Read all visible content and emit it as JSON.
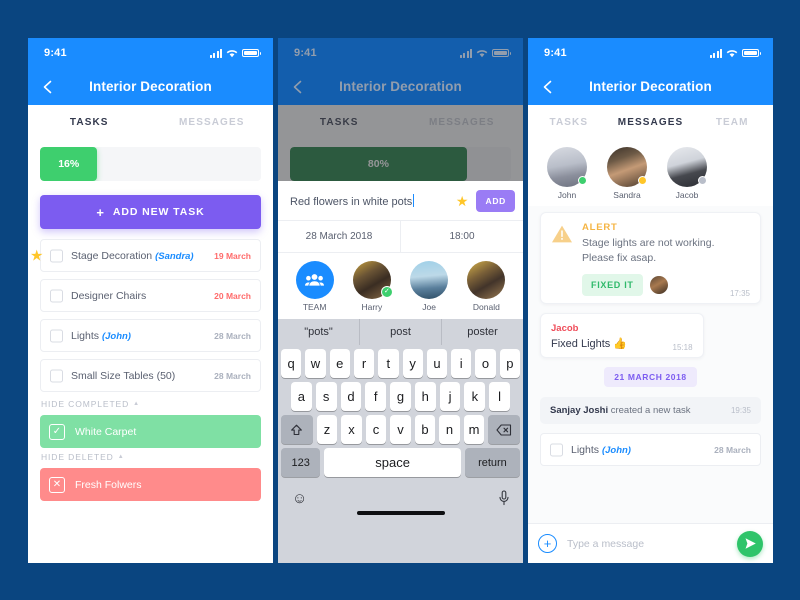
{
  "background_color": "#0a4580",
  "accent": {
    "blue": "#1a8cff",
    "green": "#3ecf6e",
    "purple": "#7c5cf0",
    "red": "#ff6b6b",
    "yellow": "#ffc629"
  },
  "status_bar": {
    "time": "9:41",
    "signal_icon": "signal-bars-icon",
    "wifi_icon": "wifi-icon",
    "battery_icon": "battery-icon"
  },
  "nav": {
    "back_icon": "chevron-left-icon",
    "title": "Interior Decoration"
  },
  "panel1": {
    "tabs": [
      {
        "label": "TASKS",
        "active": true
      },
      {
        "label": "MESSAGES",
        "active": false
      }
    ],
    "progress": {
      "percent_label": "16%",
      "percent": 16
    },
    "add_task_button": {
      "icon": "plus-icon",
      "label": "ADD NEW TASK"
    },
    "tasks": [
      {
        "starred": true,
        "name": "Stage Decoration",
        "assignee": "(Sandra)",
        "date": "19 March",
        "overdue": true
      },
      {
        "starred": false,
        "name": "Designer Chairs",
        "assignee": "",
        "date": "20 March",
        "overdue": true
      },
      {
        "starred": false,
        "name": "Lights",
        "assignee": "(John)",
        "date": "28 March",
        "overdue": false
      },
      {
        "starred": false,
        "name": "Small Size Tables (50)",
        "assignee": "",
        "date": "28 March",
        "overdue": false
      }
    ],
    "completed_section": {
      "header": "HIDE COMPLETED",
      "caret_icon": "caret-up-icon",
      "items": [
        {
          "label": "White Carpet",
          "icon": "check-icon"
        }
      ]
    },
    "deleted_section": {
      "header": "HIDE DELETED",
      "caret_icon": "caret-up-icon",
      "items": [
        {
          "label": "Fresh Folwers",
          "icon": "cross-icon"
        }
      ]
    }
  },
  "panel2": {
    "tabs": [
      {
        "label": "TASKS",
        "active": true
      },
      {
        "label": "MESSAGES",
        "active": false
      }
    ],
    "progress": {
      "percent_label": "80%",
      "percent": 80
    },
    "compose": {
      "value": "Red flowers in white pots",
      "star_icon": "star-icon",
      "add_label": "ADD"
    },
    "date_value": "28 March 2018",
    "time_value": "18:00",
    "assignees": [
      {
        "label": "TEAM",
        "icon": "people-icon",
        "selected": false
      },
      {
        "label": "Harry",
        "icon": "avatar",
        "selected": true
      },
      {
        "label": "Joe",
        "icon": "avatar",
        "selected": false
      },
      {
        "label": "Donald",
        "icon": "avatar",
        "selected": false
      }
    ],
    "keyboard": {
      "predictions": [
        "\"pots\"",
        "post",
        "poster"
      ],
      "row1": [
        "q",
        "w",
        "e",
        "r",
        "t",
        "y",
        "u",
        "i",
        "o",
        "p"
      ],
      "row2": [
        "a",
        "s",
        "d",
        "f",
        "g",
        "h",
        "j",
        "k",
        "l"
      ],
      "row3": [
        "z",
        "x",
        "c",
        "v",
        "b",
        "n",
        "m"
      ],
      "shift_icon": "shift-icon",
      "backspace_icon": "backspace-icon",
      "numbers_key": "123",
      "space_key": "space",
      "return_key": "return",
      "emoji_icon": "emoji-icon",
      "mic_icon": "microphone-icon"
    }
  },
  "panel3": {
    "tabs": [
      {
        "label": "TASKS",
        "active": false
      },
      {
        "label": "MESSAGES",
        "active": true
      },
      {
        "label": "TEAM",
        "active": false
      }
    ],
    "members": [
      {
        "name": "John",
        "status": "online"
      },
      {
        "name": "Sandra",
        "status": "away"
      },
      {
        "name": "Jacob",
        "status": "offline"
      }
    ],
    "alert": {
      "icon": "warning-triangle-icon",
      "title": "ALERT",
      "line1": "Stage lights are not working.",
      "line2": "Please fix asap.",
      "action_label": "FIXED IT",
      "time": "17:35"
    },
    "message": {
      "author": "Jacob",
      "text": "Fixed Lights 👍",
      "time": "15:18"
    },
    "date_divider": "21 MARCH 2018",
    "system_event": {
      "actor": "Sanjay Joshi",
      "text": "created a new task",
      "time": "19:35"
    },
    "task": {
      "name": "Lights",
      "assignee": "(John)",
      "date": "28 March"
    },
    "input": {
      "plus_icon": "plus-circle-icon",
      "placeholder": "Type a message",
      "send_icon": "send-icon"
    }
  }
}
